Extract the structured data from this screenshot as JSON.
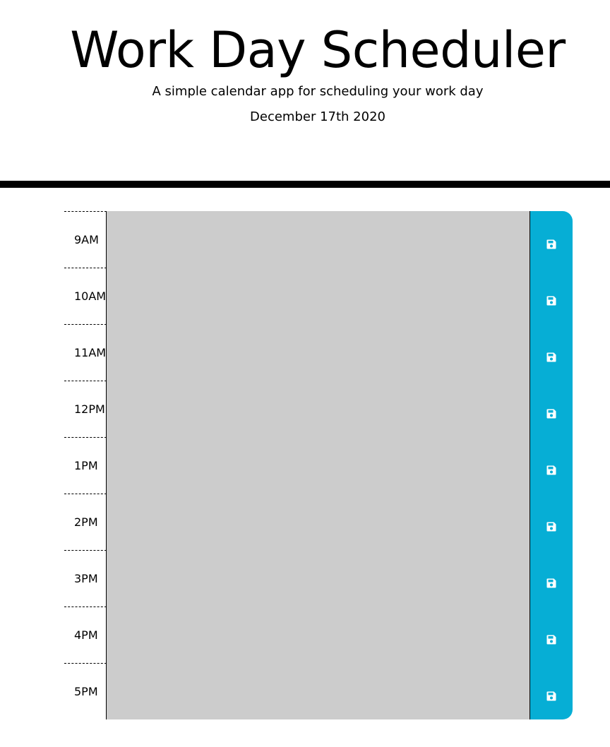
{
  "header": {
    "title": "Work Day Scheduler",
    "subtitle": "A simple calendar app for scheduling your work day",
    "current_day": "December 17th 2020"
  },
  "schedule": {
    "hours": [
      {
        "label": "9AM",
        "text": ""
      },
      {
        "label": "10AM",
        "text": ""
      },
      {
        "label": "11AM",
        "text": ""
      },
      {
        "label": "12PM",
        "text": ""
      },
      {
        "label": "1PM",
        "text": ""
      },
      {
        "label": "2PM",
        "text": ""
      },
      {
        "label": "3PM",
        "text": ""
      },
      {
        "label": "4PM",
        "text": ""
      },
      {
        "label": "5PM",
        "text": ""
      }
    ],
    "save_icon": "save-icon"
  },
  "colors": {
    "past_block": "#cccccc",
    "save_button": "#06aed5",
    "divider": "#000000"
  }
}
